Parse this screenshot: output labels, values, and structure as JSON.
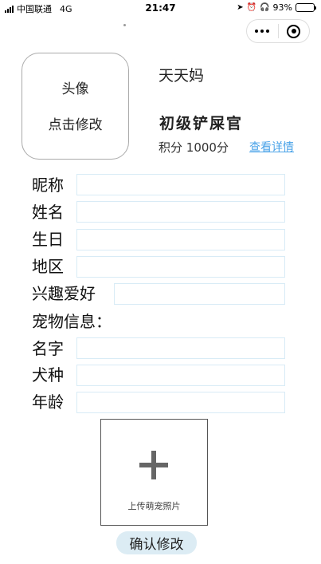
{
  "status_bar": {
    "carrier": "中国联通",
    "network": "4G",
    "time": "21:47",
    "battery_percent": "93%",
    "battery_level": 0.93
  },
  "capsule": {
    "more_icon": "more-dots-icon",
    "close_icon": "target-close-icon"
  },
  "profile": {
    "avatar_label": "头像",
    "avatar_action": "点击修改",
    "user_name": "天天妈",
    "title": "初级铲屎官",
    "points_label": "积分",
    "points_value": "1000分",
    "detail_link": "查看详情"
  },
  "form": {
    "nickname_label": "昵称",
    "name_label": "姓名",
    "birthday_label": "生日",
    "region_label": "地区",
    "hobby_label": "兴趣爱好",
    "pet_info_label": "宠物信息：",
    "pet_name_label": "名字",
    "breed_label": "犬种",
    "age_label": "年龄"
  },
  "upload": {
    "icon": "plus-icon",
    "label": "上传萌宠照片"
  },
  "confirm_button": "确认修改",
  "colors": {
    "link": "#4aa3e8",
    "input_border": "#d8ebf6",
    "button_bg": "#dcecf4"
  }
}
